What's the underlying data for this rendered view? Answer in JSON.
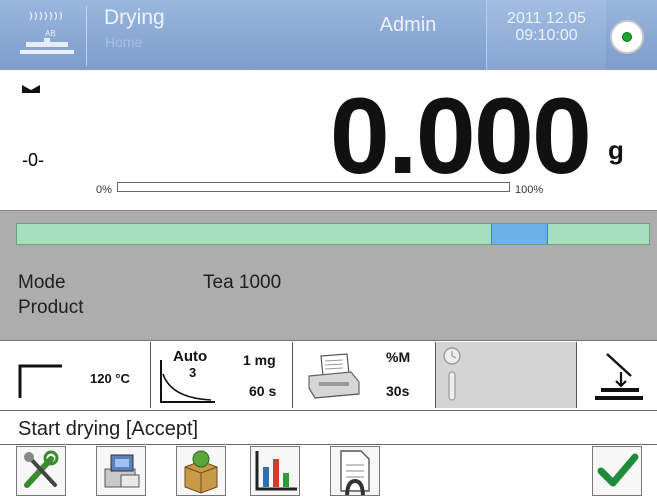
{
  "header": {
    "mode_title": "Drying",
    "breadcrumb": "Home",
    "user": "Admin",
    "date": "2011 12.05",
    "time": "09:10:00",
    "logo_icon": "drying-module-icon",
    "status_icon": "level-ok-icon"
  },
  "weighing": {
    "zero_indicator": "-0-",
    "value": "0.000",
    "unit": "g",
    "bar_min_label": "0%",
    "bar_max_label": "100%",
    "bar_fill": 0,
    "stable_icon": "stability-marker-icon"
  },
  "info": {
    "tolerance_marker_position": 0.75,
    "mode_label": "Mode",
    "mode_value": "Tea 1000",
    "product_label": "Product"
  },
  "function_keys": {
    "temp": {
      "value": "120 °C",
      "icon": "temperature-profile-icon"
    },
    "auto": {
      "title": "Auto",
      "number": "3",
      "mass": "1 mg",
      "time": "60 s",
      "icon": "auto-drying-curve-icon"
    },
    "print": {
      "unit": "%M",
      "interval": "30s",
      "icon": "printer-icon"
    },
    "disabled": {
      "icon": "thermometer-clock-icon"
    },
    "tare": {
      "icon": "tare-pan-icon"
    }
  },
  "status": {
    "text": "Start drying [Accept]"
  },
  "bottom": {
    "buttons": [
      {
        "icon": "settings-tools-icon"
      },
      {
        "icon": "database-icon"
      },
      {
        "icon": "products-box-icon"
      },
      {
        "icon": "report-chart-icon"
      },
      {
        "icon": "document-icon"
      },
      {
        "icon": "accept-check-icon"
      }
    ]
  },
  "colors": {
    "header": "#7e9ccc",
    "panel": "#adadad",
    "tolerance": "#a6dfbe",
    "marker": "#6cb0e8",
    "accept": "#1f8c3b"
  }
}
